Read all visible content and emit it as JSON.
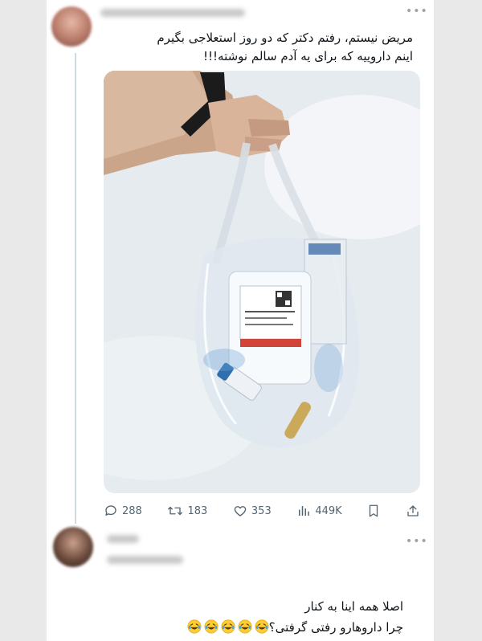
{
  "tweet": {
    "text_line1": "مریض نیستم، رفتم دکتر که دو روز استعلاجی بگیرم",
    "text_line2": "اینم داروییه که برای یه آدم سالم نوشته!!!",
    "stats": {
      "replies": "288",
      "retweets": "183",
      "likes": "353",
      "views": "449K"
    },
    "icons": [
      "reply-icon",
      "retweet-icon",
      "like-icon",
      "views-icon",
      "bookmark-icon",
      "share-icon",
      "more-icon"
    ]
  },
  "reply": {
    "text_line1": "اصلا همه اینا به کنار",
    "text_line2": "چرا داروهارو رفتی گرفتی؟",
    "emoji_name": "laughing-tears-emoji",
    "emoji_count": 5
  },
  "colors": {
    "thread_line": "#cfd9de",
    "secondary_text": "#536471",
    "pill_cap_blue": "#2f6fb0",
    "label_red": "#d0443a"
  }
}
